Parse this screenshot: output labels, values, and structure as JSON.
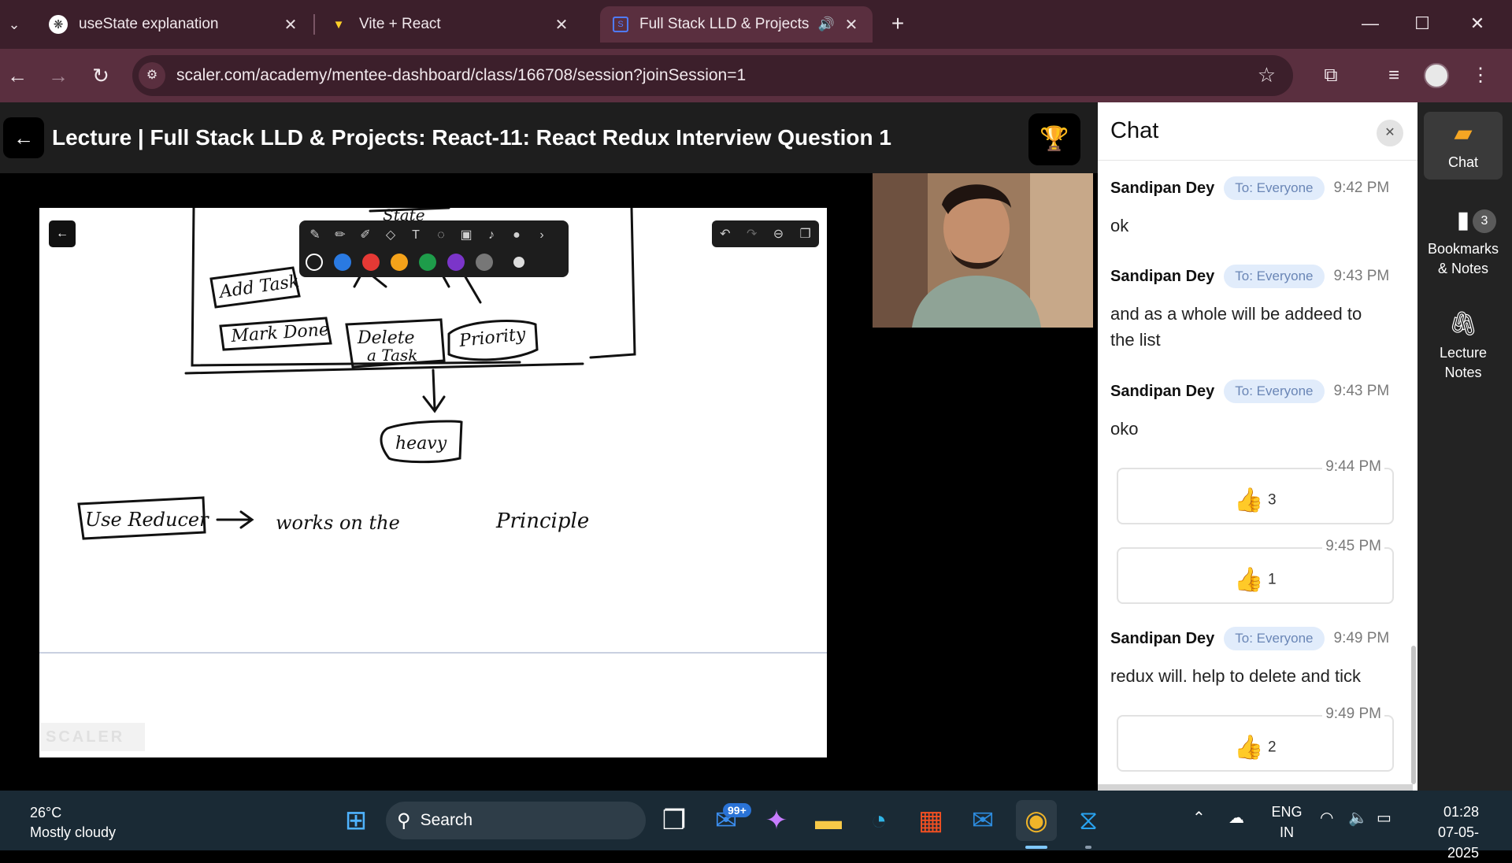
{
  "browser": {
    "tabs": [
      {
        "title": "useState explanation",
        "icon": "chatgpt-icon"
      },
      {
        "title": "Vite + React",
        "icon": "vite-icon"
      },
      {
        "title": "Full Stack LLD & Projects: R",
        "icon": "scaler-icon",
        "audio": true
      }
    ],
    "url": "scaler.com/academy/mentee-dashboard/class/166708/session?joinSession=1"
  },
  "lecture": {
    "title": "Lecture | Full Stack LLD & Projects: React-11: React Redux Interview Question 1"
  },
  "board": {
    "colors": [
      "#ffffff",
      "#2a7ae2",
      "#e53935",
      "#f4a21a",
      "#1e9c4a",
      "#7b35c9",
      "#777777"
    ],
    "ink_texts": {
      "state": "State",
      "add_task": "Add Task",
      "mark_done": "Mark Done",
      "delete": "Delete",
      "a_task": "a Task",
      "priority": "Priority",
      "heavy": "heavy",
      "use_reducer": "Use Reducer",
      "works_on": "works on the",
      "principle": "Principle"
    },
    "watermark": "SCALER"
  },
  "chat": {
    "title": "Chat",
    "messages": [
      {
        "sender": "Sandipan Dey",
        "to": "To: Everyone",
        "time": "9:42 PM",
        "text": "ok"
      },
      {
        "sender": "Sandipan Dey",
        "to": "To: Everyone",
        "time": "9:43 PM",
        "text": "and as a whole will be addeed to the list"
      },
      {
        "sender": "Sandipan Dey",
        "to": "To: Everyone",
        "time": "9:43 PM",
        "text": "oko"
      },
      {
        "sender": "Sandipan Dey",
        "to": "To: Everyone",
        "time": "9:49 PM",
        "text": "redux will. help to delete and tick"
      }
    ],
    "reactions": [
      {
        "time": "9:44 PM",
        "count": "3"
      },
      {
        "time": "9:45 PM",
        "count": "1"
      },
      {
        "time": "9:49 PM",
        "count": "2"
      }
    ]
  },
  "rail": {
    "chat": "Chat",
    "bookmarks_line1": "Bookmarks",
    "bookmarks_line2": "& Notes",
    "bookmarks_count": "3",
    "notes_line1": "Lecture",
    "notes_line2": "Notes"
  },
  "taskbar": {
    "temp": "26°C",
    "weather": "Mostly cloudy",
    "search": "Search",
    "mail_badge": "99+",
    "lang1": "ENG",
    "lang2": "IN",
    "time": "01:28",
    "date": "07-05-2025"
  }
}
